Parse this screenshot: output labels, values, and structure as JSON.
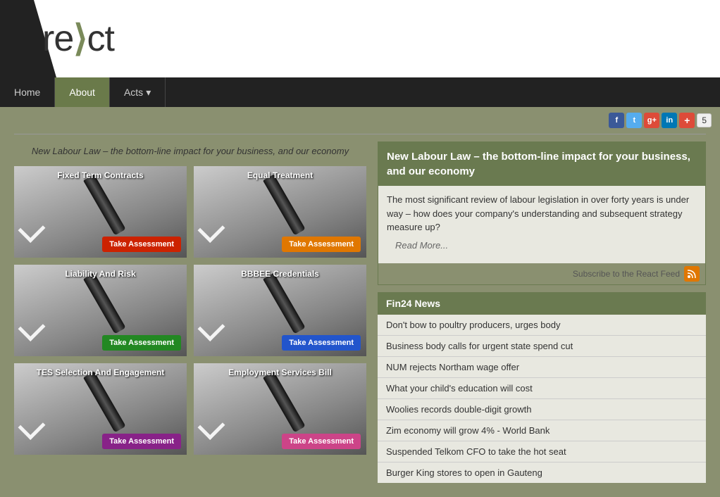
{
  "header": {
    "logo_re": "re",
    "logo_arrow": "⟨",
    "logo_ct": "ct",
    "logo_full": "re-Act"
  },
  "nav": {
    "items": [
      {
        "label": "Home",
        "active": false
      },
      {
        "label": "About",
        "active": true
      },
      {
        "label": "Acts",
        "active": false
      }
    ],
    "dropdown_icon": "▾"
  },
  "social": {
    "fb": "f",
    "tw": "t",
    "gp": "g+",
    "li": "in",
    "ho": "+",
    "count": "5"
  },
  "page_headline": "New Labour Law – the bottom-line impact for your business, and our economy",
  "assessments": [
    {
      "title": "Fixed Term Contracts",
      "btn_label": "Take Assessment",
      "btn_class": "btn-red"
    },
    {
      "title": "Equal Treatment",
      "btn_label": "Take Assessment",
      "btn_class": "btn-orange"
    },
    {
      "title": "Liability And Risk",
      "btn_label": "Take Assessment",
      "btn_class": "btn-green"
    },
    {
      "title": "BBBEE Credentials",
      "btn_label": "Take Assessment",
      "btn_class": "btn-blue"
    },
    {
      "title": "TES Selection And Engagement",
      "btn_label": "Take Assessment",
      "btn_class": "btn-purple"
    },
    {
      "title": "Employment Services Bill",
      "btn_label": "Take Assessment",
      "btn_class": "btn-pink"
    }
  ],
  "featured": {
    "title": "New Labour Law – the bottom-line impact for your business, and our economy",
    "body": "The most significant review of labour legislation in over forty years is under way – how does your company's understanding and subsequent strategy measure up?",
    "read_more": "Read More...",
    "subscribe_text": "Subscribe to the React Feed"
  },
  "fin24": {
    "header": "Fin24 News",
    "items": [
      "Don't bow to poultry producers, urges body",
      "Business body calls for urgent state spend cut",
      "NUM rejects Northam wage offer",
      "What your child's education will cost",
      "Woolies records double-digit growth",
      "Zim economy will grow 4% - World Bank",
      "Suspended Telkom CFO to take the hot seat",
      "Burger King stores to open in Gauteng"
    ]
  }
}
